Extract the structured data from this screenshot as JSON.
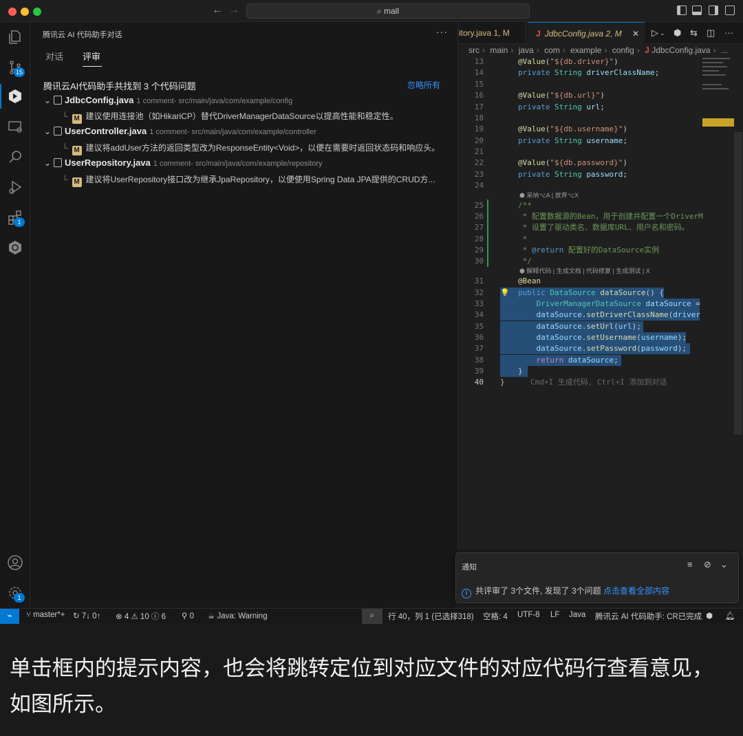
{
  "titlebar": {
    "search": "mall"
  },
  "activity": {
    "scm_badge": "15",
    "ext_badge": "1",
    "settings_badge": "1"
  },
  "panel": {
    "title": "腾讯云 AI 代码助手对话",
    "tabs": [
      "对话",
      "评审"
    ],
    "summary": "腾讯云AI代码助手共找到 3 个代码问题",
    "ignore_all": "忽略所有",
    "files": [
      {
        "name": "JdbcConfig.java",
        "meta": "1 comment- src/main/java/com/example/config",
        "badge": "M",
        "comment": "建议使用连接池（如HikariCP）替代DriverManagerDataSource以提高性能和稳定性。"
      },
      {
        "name": "UserController.java",
        "meta": "1 comment- src/main/java/com/example/controller",
        "badge": "M",
        "comment": "建议将addUser方法的返回类型改为ResponseEntity<Void>，以便在需要时返回状态码和响应头。"
      },
      {
        "name": "UserRepository.java",
        "meta": "1 comment- src/main/java/com/example/repository",
        "badge": "M",
        "comment": "建议将UserRepository接口改为继承JpaRepository，以便使用Spring Data JPA提供的CRUD方..."
      }
    ]
  },
  "editor": {
    "tab1": "itory.java 1, M",
    "tab2_icon": "J",
    "tab2": "JdbcConfig.java 2, M",
    "breadcrumb": [
      "src",
      "main",
      "java",
      "com",
      "example",
      "config",
      "JdbcConfig.java",
      "..."
    ],
    "hint_accept": "采纳⌥A | 放弃⌥X",
    "hint_actions": "解释代码 | 生成文档 | 代码修复 | 生成测试 | X",
    "ghost": "Cmd+I 生成代码, Ctrl+I 添加到对话",
    "line_numbers": [
      "13",
      "14",
      "15",
      "16",
      "17",
      "18",
      "19",
      "20",
      "21",
      "22",
      "23",
      "24",
      "25",
      "26",
      "27",
      "28",
      "29",
      "30",
      "31",
      "32",
      "33",
      "34",
      "35",
      "36",
      "37",
      "38",
      "39",
      "40"
    ]
  },
  "notification": {
    "title": "通知",
    "message": "共评审了 3个文件, 发现了 3个问题",
    "link": "点击查看全部内容"
  },
  "statusbar": {
    "branch": "master*+",
    "sync": "7↓ 0↑",
    "problems": "⊗ 4 ⚠ 10 ⓘ 6",
    "ports": "0",
    "java": "Java: Warning",
    "cursor": "行 40，列 1 (已选择318)",
    "spaces": "空格: 4",
    "encoding": "UTF-8",
    "eol": "LF",
    "lang": "Java",
    "assistant": "腾讯云 AI 代码助手: CR已完成"
  },
  "caption": "单击框内的提示内容，也会将跳转定位到对应文件的对应代码行查看意见，如图所示。"
}
